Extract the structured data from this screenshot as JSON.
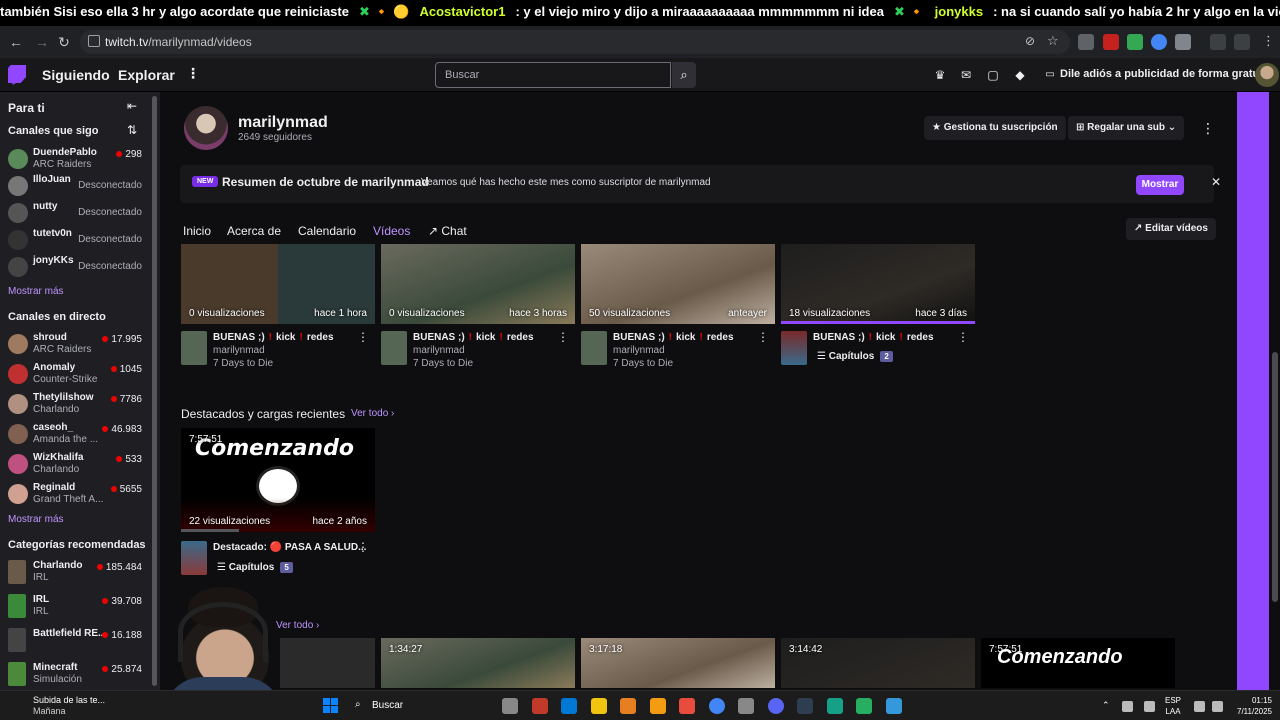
{
  "ticker": {
    "segments": [
      {
        "text": "también Sisi eso ella 3 hr y algo acordate que reiniciaste",
        "cls": ""
      },
      {
        "text": "✖ 🔸 🟡",
        "cls": "g"
      },
      {
        "text": "Acostavictor1",
        "cls": "u"
      },
      {
        "text": ": y el viejo miro y dijo a miraaaaaaaaaa mmmmmmm ni idea",
        "cls": ""
      },
      {
        "text": "✖ 🔸",
        "cls": "g"
      },
      {
        "text": "jonykks",
        "cls": "u"
      },
      {
        "text": ": na si cuando salí yo había 2 hr y algo en la violeta",
        "cls": ""
      }
    ]
  },
  "browser": {
    "url_host": "twitch.tv",
    "url_path": "/marilynmad/videos"
  },
  "topnav": {
    "following": "Siguiendo",
    "explore": "Explorar",
    "search_placeholder": "Buscar",
    "adfree": "Dile adiós a publicidad de forma gratuita"
  },
  "sidebar": {
    "title": "Para ti",
    "followed_header": "Canales que sigo",
    "followed": [
      {
        "name": "DuendePablo",
        "sub": "ARC Raiders",
        "right": "298",
        "live": true,
        "color": "#5a8a5a"
      },
      {
        "name": "IlloJuan",
        "sub": "",
        "right": "Desconectado",
        "live": false,
        "color": "#777"
      },
      {
        "name": "nutty",
        "sub": "",
        "right": "Desconectado",
        "live": false,
        "color": "#555"
      },
      {
        "name": "tutetv0n",
        "sub": "",
        "right": "Desconectado",
        "live": false,
        "color": "#333"
      },
      {
        "name": "jonyKKs",
        "sub": "",
        "right": "Desconectado",
        "live": false,
        "color": "#444"
      }
    ],
    "show_more_1": "Mostrar más",
    "live_header": "Canales en directo",
    "live": [
      {
        "name": "shroud",
        "sub": "ARC Raiders",
        "right": "17.995",
        "color": "#a07a60"
      },
      {
        "name": "Anomaly",
        "sub": "Counter-Strike",
        "right": "1045",
        "color": "#c03030"
      },
      {
        "name": "Thetylilshow",
        "sub": "Charlando",
        "right": "7786",
        "color": "#b09080"
      },
      {
        "name": "caseoh_",
        "sub": "Amanda the ...",
        "right": "46.983",
        "color": "#806050"
      },
      {
        "name": "WizKhalifa",
        "sub": "Charlando",
        "right": "533",
        "color": "#c05080"
      },
      {
        "name": "Reginald",
        "sub": "Grand Theft A...",
        "right": "5655",
        "color": "#d0a090"
      }
    ],
    "show_more_2": "Mostrar más",
    "cat_header": "Categorías recomendadas",
    "categories": [
      {
        "name": "Charlando",
        "sub": "IRL",
        "right": "185.484",
        "color": "#6a5a4a"
      },
      {
        "name": "IRL",
        "sub": "IRL",
        "right": "39.708",
        "color": "#3a8a3a"
      },
      {
        "name": "Battlefield RE...",
        "sub": "",
        "right": "16.188",
        "color": "#444"
      },
      {
        "name": "Minecraft",
        "sub": "Simulación",
        "right": "25.874",
        "color": "#4a8a3a"
      }
    ]
  },
  "channel": {
    "name": "marilynmad",
    "followers": "2649 seguidores",
    "manage_sub": "Gestiona tu suscripción",
    "gift_sub": "Regalar una sub"
  },
  "banner": {
    "badge": "NEW",
    "title": "Resumen de octubre de marilynmad",
    "subtitle": "Veamos qué has hecho este mes como suscriptor de marilynmad",
    "show": "Mostrar"
  },
  "tabs": [
    {
      "label": "Inicio",
      "active": false
    },
    {
      "label": "Acerca de",
      "active": false
    },
    {
      "label": "Calendario",
      "active": false
    },
    {
      "label": "Vídeos",
      "active": true
    },
    {
      "label": "Chat",
      "active": false
    }
  ],
  "edit_videos": "Editar vídeos",
  "videos_row": [
    {
      "views": "0 visualizaciones",
      "age": "hace 1 hora",
      "t1": "BUENAS ;)",
      "t2": "kick",
      "t3": "redes",
      "channel": "marilynmad",
      "game": "7 Days to Die",
      "progress": 0,
      "chapters": null
    },
    {
      "views": "0 visualizaciones",
      "age": "hace 3 horas",
      "t1": "BUENAS ;)",
      "t2": "kick",
      "t3": "redes",
      "channel": "marilynmad",
      "game": "7 Days to Die",
      "progress": 0,
      "chapters": null
    },
    {
      "views": "50 visualizaciones",
      "age": "anteayer",
      "t1": "BUENAS ;)",
      "t2": "kick",
      "t3": "redes",
      "channel": "marilynmad",
      "game": "7 Days to Die",
      "progress": 0,
      "chapters": null
    },
    {
      "views": "18 visualizaciones",
      "age": "hace 3 días",
      "t1": "BUENAS ;)",
      "t2": "kick",
      "t3": "redes",
      "channel": "",
      "game": "",
      "progress": 1.0,
      "chapters": {
        "label": "Capítulos",
        "count": "2"
      }
    }
  ],
  "highlights": {
    "title": "Destacados y cargas recientes",
    "see_all": "Ver todo ›",
    "card": {
      "duration": "7:57:51",
      "thumb_text": "Comenzando",
      "views": "22 visualizaciones",
      "age": "hace 2 años",
      "title": "Destacado: 🔴 PASA A SALUD...",
      "chapters": {
        "label": "Capítulos",
        "count": "5"
      }
    }
  },
  "bottom_row": {
    "see_all": "Ver todo ›",
    "durations": [
      "1:34:27",
      "3:17:18",
      "3:14:42",
      "7:57:51"
    ],
    "last_thumb_text": "Comenzando"
  },
  "taskbar": {
    "weather_line1": "Subida de las te...",
    "weather_line2": "Mañana",
    "search": "Buscar",
    "lang1": "ESP",
    "lang2": "LAA",
    "time": "01:15",
    "date": "7/11/2025"
  },
  "colors": {
    "accent": "#9147ff",
    "accent_text": "#bf94ff",
    "live_red": "#eb0400"
  }
}
